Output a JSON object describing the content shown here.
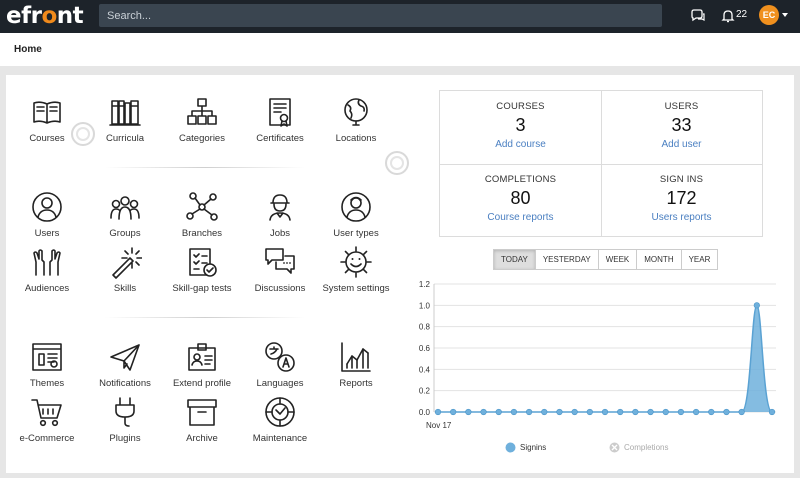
{
  "header": {
    "logo_text": "efr",
    "logo_o": "o",
    "logo_text2": "nt",
    "search_placeholder": "Search...",
    "notification_count": "22",
    "avatar_initials": "EC"
  },
  "breadcrumb": "Home",
  "tiles": [
    {
      "label": "Courses",
      "icon": "book-icon"
    },
    {
      "label": "Curricula",
      "icon": "books-icon"
    },
    {
      "label": "Categories",
      "icon": "hierarchy-icon"
    },
    {
      "label": "Certificates",
      "icon": "certificate-icon"
    },
    {
      "label": "Locations",
      "icon": "globe-icon"
    },
    {
      "label": "Users",
      "icon": "user-icon"
    },
    {
      "label": "Groups",
      "icon": "group-icon"
    },
    {
      "label": "Branches",
      "icon": "branches-icon"
    },
    {
      "label": "Jobs",
      "icon": "worker-icon"
    },
    {
      "label": "User types",
      "icon": "user-type-icon"
    },
    {
      "label": "Audiences",
      "icon": "raised-hands-icon"
    },
    {
      "label": "Skills",
      "icon": "magic-wand-icon"
    },
    {
      "label": "Skill-gap tests",
      "icon": "checklist-icon"
    },
    {
      "label": "Discussions",
      "icon": "discussion-icon"
    },
    {
      "label": "System settings",
      "icon": "gear-smile-icon"
    },
    {
      "label": "Themes",
      "icon": "themes-icon"
    },
    {
      "label": "Notifications",
      "icon": "paper-plane-icon"
    },
    {
      "label": "Extend profile",
      "icon": "id-card-icon"
    },
    {
      "label": "Languages",
      "icon": "languages-icon"
    },
    {
      "label": "Reports",
      "icon": "chart-icon"
    },
    {
      "label": "e-Commerce",
      "icon": "cart-icon"
    },
    {
      "label": "Plugins",
      "icon": "plug-icon"
    },
    {
      "label": "Archive",
      "icon": "archive-box-icon"
    },
    {
      "label": "Maintenance",
      "icon": "maintenance-icon"
    }
  ],
  "stats": [
    {
      "label": "COURSES",
      "value": "3",
      "link": "Add course"
    },
    {
      "label": "USERS",
      "value": "33",
      "link": "Add user"
    },
    {
      "label": "COMPLETIONS",
      "value": "80",
      "link": "Course reports"
    },
    {
      "label": "SIGN INS",
      "value": "172",
      "link": "Users reports"
    }
  ],
  "periods": [
    "TODAY",
    "YESTERDAY",
    "WEEK",
    "MONTH",
    "YEAR"
  ],
  "active_period": "TODAY",
  "chart_data": {
    "type": "area",
    "x_tick_labels": [
      "Nov 17"
    ],
    "ylim": [
      0,
      1.2
    ],
    "y_ticks": [
      "0.0",
      "0.2",
      "0.4",
      "0.6",
      "0.8",
      "1.0",
      "1.2"
    ],
    "series": [
      {
        "name": "Signins",
        "color": "#6fb0dc",
        "values": [
          0,
          0,
          0,
          0,
          0,
          0,
          0,
          0,
          0,
          0,
          0,
          0,
          0,
          0,
          0,
          0,
          0,
          0,
          0,
          0,
          0,
          1,
          0
        ]
      },
      {
        "name": "Completions",
        "color": "#cccccc",
        "hidden": true,
        "values": []
      }
    ],
    "legend": "bottom",
    "grid": true
  }
}
